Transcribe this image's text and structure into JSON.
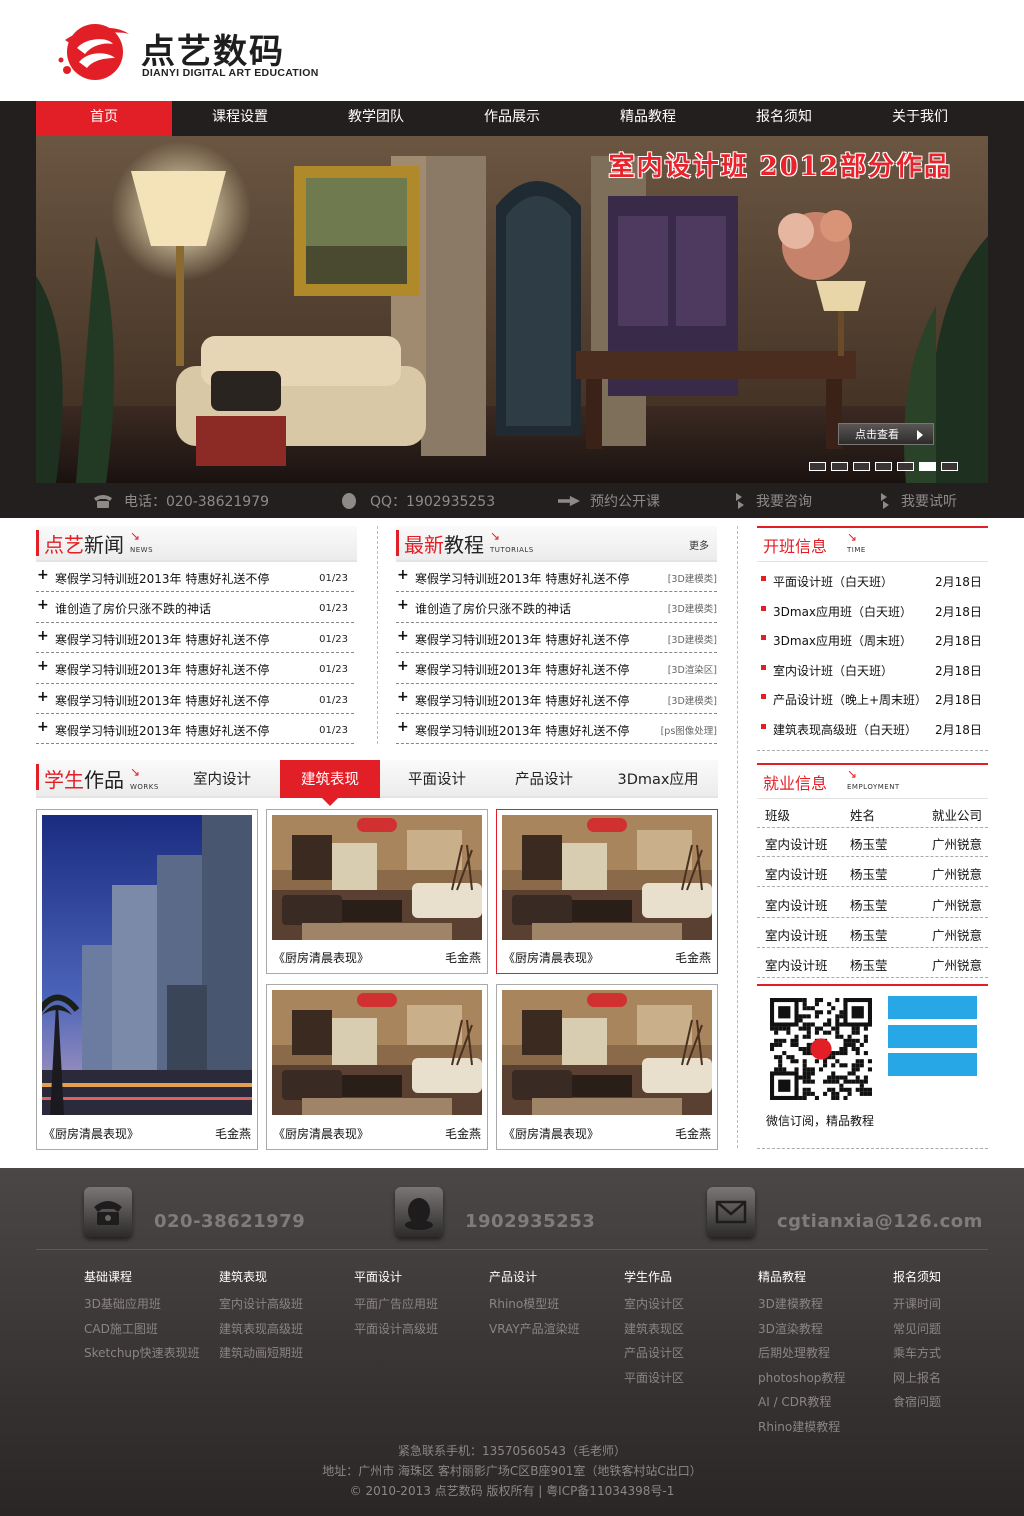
{
  "brand": {
    "title": "点艺数码",
    "subtitle": "DIANYI DIGITAL ART EDUCATION",
    "accent": "#e21e26"
  },
  "nav": [
    "首页",
    "课程设置",
    "教学团队",
    "作品展示",
    "精品教程",
    "报名须知",
    "关于我们"
  ],
  "banner": {
    "caption": "室内设计班 2012部分作品",
    "button": "点击查看",
    "slides_total": 7,
    "current_slide": 6
  },
  "infobar": {
    "phone": "电话：020-38621979",
    "qq": "QQ：1902935253",
    "open_class": "预约公开课",
    "consult": "我要咨询",
    "trial": "我要试听"
  },
  "news": {
    "title_red": "点艺",
    "title_black": "新闻",
    "title_en": "NEWS",
    "items": [
      {
        "title": "寒假学习特训班2013年  特惠好礼送不停",
        "date": "01/23"
      },
      {
        "title": "谁创造了房价只涨不跌的神话",
        "date": "01/23"
      },
      {
        "title": "寒假学习特训班2013年  特惠好礼送不停",
        "date": "01/23"
      },
      {
        "title": "寒假学习特训班2013年  特惠好礼送不停",
        "date": "01/23"
      },
      {
        "title": "寒假学习特训班2013年  特惠好礼送不停",
        "date": "01/23"
      },
      {
        "title": "寒假学习特训班2013年  特惠好礼送不停",
        "date": "01/23"
      }
    ]
  },
  "tutorials": {
    "title_red": "最新",
    "title_black": "教程",
    "title_en": "TUTORIALS",
    "more": "更多",
    "items": [
      {
        "title": "寒假学习特训班2013年  特惠好礼送不停",
        "tag": "[3D建模类]"
      },
      {
        "title": "谁创造了房价只涨不跌的神话",
        "tag": "[3D建模类]"
      },
      {
        "title": "寒假学习特训班2013年  特惠好礼送不停",
        "tag": "[3D建模类]"
      },
      {
        "title": "寒假学习特训班2013年  特惠好礼送不停",
        "tag": "[3D渲染区]"
      },
      {
        "title": "寒假学习特训班2013年  特惠好礼送不停",
        "tag": "[3D建模类]"
      },
      {
        "title": "寒假学习特训班2013年  特惠好礼送不停",
        "tag": "[ps图像处理]"
      }
    ]
  },
  "classes": {
    "title": "开班信息",
    "title_en": "TIME",
    "items": [
      {
        "name": "平面设计班（白天班）",
        "date": "2月18日"
      },
      {
        "name": "3Dmax应用班（白天班）",
        "date": "2月18日"
      },
      {
        "name": "3Dmax应用班（周末班）",
        "date": "2月18日"
      },
      {
        "name": "室内设计班（白天班）",
        "date": "2月18日"
      },
      {
        "name": "产品设计班（晚上+周末班）",
        "date": "2月18日"
      },
      {
        "name": "建筑表现高级班（白天班）",
        "date": "2月18日"
      }
    ]
  },
  "employment": {
    "title": "就业信息",
    "title_en": "EMPLOYMENT",
    "headers": [
      "班级",
      "姓名",
      "就业公司"
    ],
    "rows": [
      [
        "室内设计班",
        "杨玉莹",
        "广州锐意"
      ],
      [
        "室内设计班",
        "杨玉莹",
        "广州锐意"
      ],
      [
        "室内设计班",
        "杨玉莹",
        "广州锐意"
      ],
      [
        "室内设计班",
        "杨玉莹",
        "广州锐意"
      ],
      [
        "室内设计班",
        "杨玉莹",
        "广州锐意"
      ]
    ]
  },
  "works": {
    "title_red": "学生",
    "title_black": "作品",
    "title_en": "WORKS",
    "tabs": [
      "室内设计",
      "建筑表现",
      "平面设计",
      "产品设计",
      "3Dmax应用"
    ],
    "active_tab": 1,
    "cards": [
      {
        "caption": "《厨房清晨表现》",
        "author": "毛金燕"
      },
      {
        "caption": "《厨房清晨表现》",
        "author": "毛金燕"
      },
      {
        "caption": "《厨房清晨表现》",
        "author": "毛金燕"
      },
      {
        "caption": "《厨房清晨表现》",
        "author": "毛金燕"
      },
      {
        "caption": "《厨房清晨表现》",
        "author": "毛金燕"
      }
    ]
  },
  "wechat": {
    "text": "微信订阅，精品教程",
    "button_color": "#27a7e6"
  },
  "footer": {
    "phone": "020-38621979",
    "qq": "1902935253",
    "email": "cgtianxia@126.com",
    "columns": [
      {
        "head": "基础课程",
        "links": [
          "3D基础应用班",
          "CAD施工图班",
          "Sketchup快速表现班"
        ]
      },
      {
        "head": "建筑表现",
        "links": [
          "室内设计高级班",
          "建筑表现高级班",
          "建筑动画短期班"
        ]
      },
      {
        "head": "平面设计",
        "links": [
          "平面广告应用班",
          "平面设计高级班"
        ]
      },
      {
        "head": "产品设计",
        "links": [
          "Rhino模型班",
          "VRAY产品渲染班"
        ]
      },
      {
        "head": "学生作品",
        "links": [
          "室内设计区",
          "建筑表现区",
          "产品设计区",
          "平面设计区"
        ]
      },
      {
        "head": "精品教程",
        "links": [
          "3D建模教程",
          "3D渲染教程",
          "后期处理教程",
          "photoshop教程",
          "AI / CDR教程",
          "Rhino建模教程"
        ]
      },
      {
        "head": "报名须知",
        "links": [
          "开课时间",
          "常见问题",
          "乘车方式",
          "网上报名",
          "食宿问题"
        ]
      }
    ],
    "contact": "紧急联系手机：13570560543（毛老师）",
    "address": "地址：广州市 海珠区 客村丽影广场C区B座901室（地铁客村站C出口）",
    "copyright": "© 2010-2013   点艺数码 版权所有 | 粤ICP备11034398号-1"
  }
}
